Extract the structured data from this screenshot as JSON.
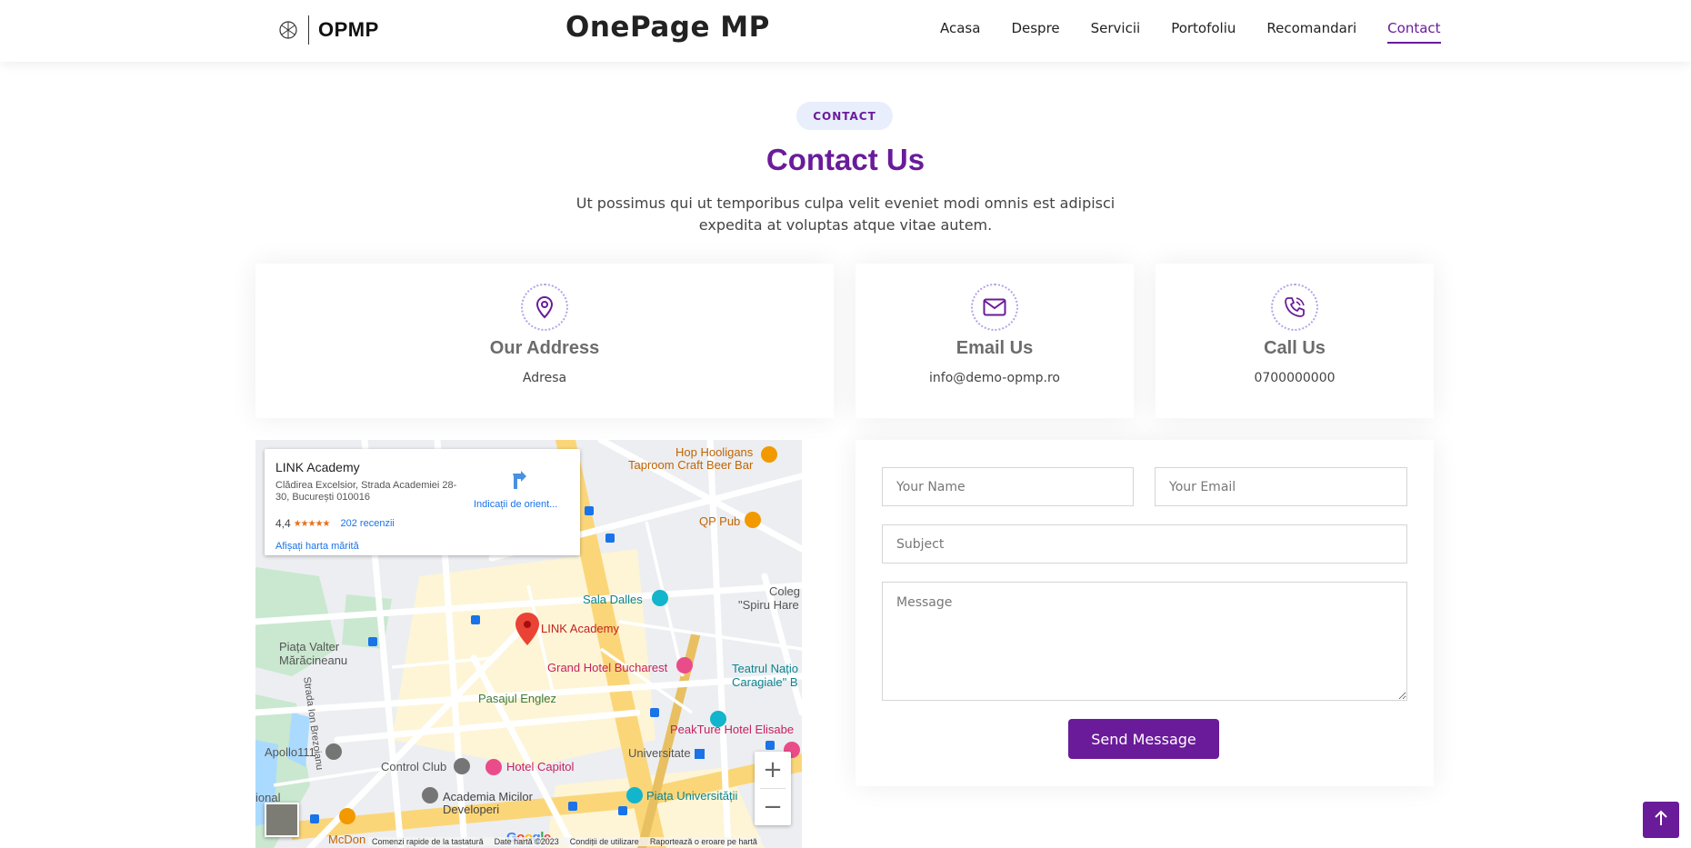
{
  "header": {
    "logo_text": "OPMP",
    "site_title": "OnePage MP",
    "nav": [
      {
        "label": "Acasa"
      },
      {
        "label": "Despre"
      },
      {
        "label": "Servicii"
      },
      {
        "label": "Portofoliu"
      },
      {
        "label": "Recomandari"
      },
      {
        "label": "Contact",
        "active": true
      }
    ]
  },
  "section": {
    "pill": "CONTACT",
    "title": "Contact Us",
    "subtitle": "Ut possimus qui ut temporibus culpa velit eveniet modi omnis est adipisci expedita at voluptas atque vitae autem."
  },
  "info_boxes": {
    "address": {
      "icon": "map-pin-icon",
      "title": "Our Address",
      "value": "Adresa"
    },
    "email": {
      "icon": "envelope-icon",
      "title": "Email Us",
      "value": "info@demo-opmp.ro"
    },
    "phone": {
      "icon": "phone-icon",
      "title": "Call Us",
      "value": "0700000000"
    }
  },
  "map": {
    "place_name": "LINK Academy",
    "address": "Clădirea Excelsior, Strada Academiei 28-30, București 010016",
    "rating": "4,4",
    "stars": "★★★★★",
    "reviews": "202 recenzii",
    "directions": "Indicații de orient...",
    "bigger_map": "Afișați harta mărită",
    "labels": {
      "hop": "Hop Hooligans",
      "taproom": "Taproom Craft Beer Bar",
      "qp_pub": "QP Pub",
      "sala_dalles": "Sala Dalles",
      "coleg": "Coleg",
      "spiru": "\"Spiru Hare",
      "link": "LINK Academy",
      "piata_valter": "Piața Valter",
      "maracineanu": "Mărăcineanu",
      "grand_hotel": "Grand Hotel Bucharest",
      "teatrul": "Teatrul Națio",
      "caragiale": "Caragiale\" B",
      "strada_brezoianu": "Strada Ion Brezoianu",
      "pasajul": "Pasajul Englez",
      "peakture": "PeakTure Hotel Elisabe",
      "apollo": "Apollo111",
      "universitate": "Universitate",
      "control_club": "Control Club",
      "hotel_capitol": "Hotel Capitol",
      "academia_1": "Academia Micilor",
      "academia_2": "Developeri",
      "piata_univ": "Piața Universității",
      "national": "ional",
      "mcdon": "McDon"
    },
    "zoom_in": "+",
    "zoom_out": "−",
    "google": "Google",
    "footer": [
      "Comenzi rapide de la tastatură",
      "Date hartă ©2023",
      "Condiții de utilizare",
      "Raportează o eroare pe hartă"
    ]
  },
  "form": {
    "name_placeholder": "Your Name",
    "email_placeholder": "Your Email",
    "subject_placeholder": "Subject",
    "message_placeholder": "Message",
    "send_label": "Send Message"
  },
  "colors": {
    "accent": "#6a1b9a",
    "pill_bg": "#e8eefb"
  }
}
